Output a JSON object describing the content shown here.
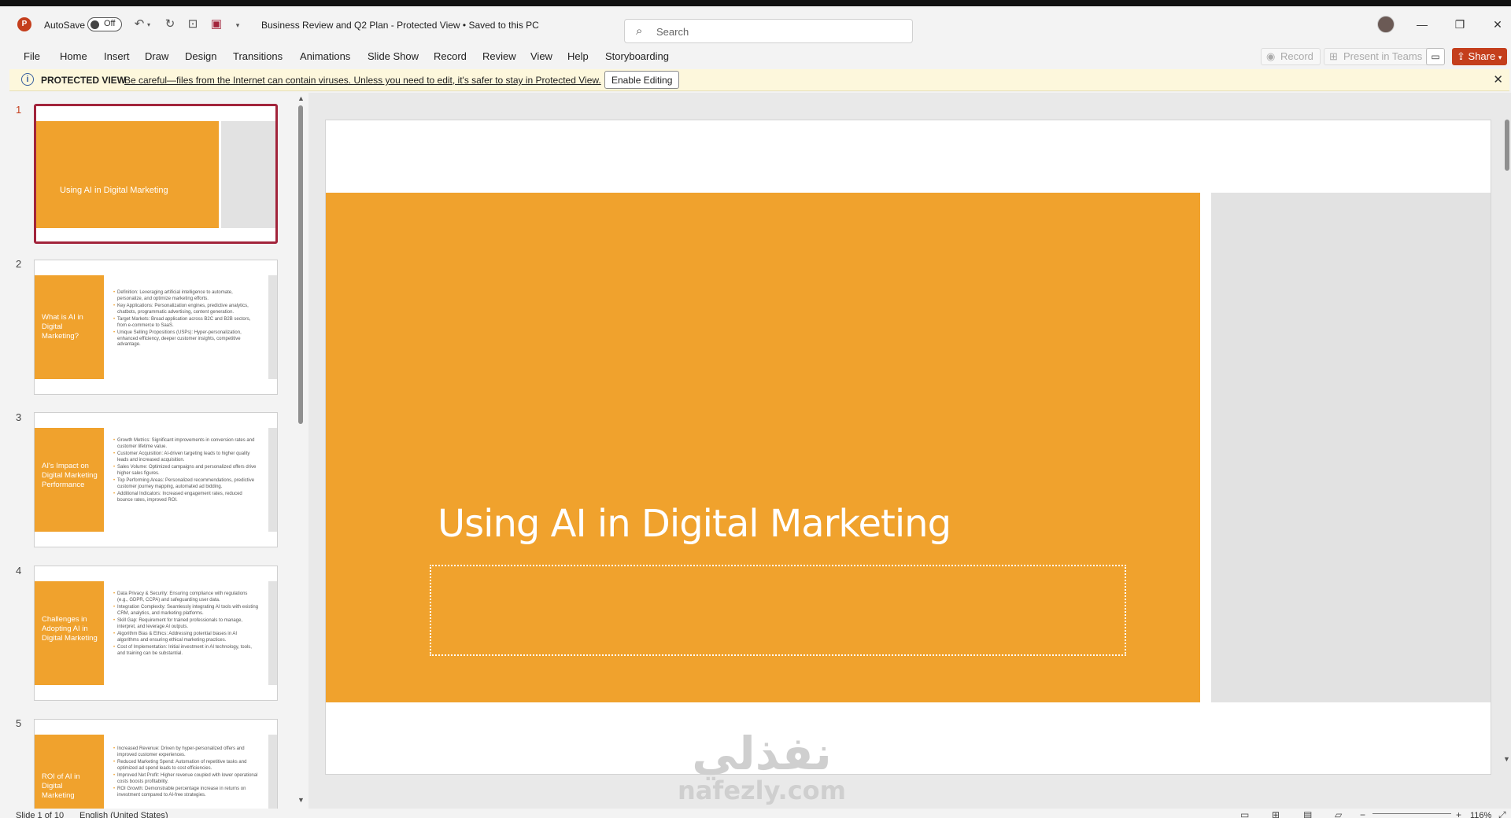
{
  "app": {
    "autosave_label": "AutoSave",
    "autosave_state": "Off",
    "doc_title": "Business Review and Q2 Plan  -  Protected View  •  Saved to this PC",
    "search_placeholder": "Search",
    "brand_color": "#c43e1c",
    "icons": [
      "powerpoint-logo-icon",
      "undo-icon",
      "redo-icon",
      "present-icon",
      "save-icon",
      "customize-icon",
      "search-icon",
      "avatar",
      "minimize-icon",
      "restore-icon",
      "close-icon"
    ]
  },
  "menu": {
    "items": [
      "File",
      "Home",
      "Insert",
      "Draw",
      "Design",
      "Transitions",
      "Animations",
      "Slide Show",
      "Record",
      "Review",
      "View",
      "Help",
      "Storyboarding"
    ],
    "record_label": "Record",
    "present_teams_label": "Present in Teams",
    "share_label": "Share"
  },
  "protected_view": {
    "title": "PROTECTED VIEW",
    "message": "Be careful—files from the Internet can contain viruses. Unless you need to edit, it's safer to stay in Protected View.",
    "button": "Enable Editing"
  },
  "slides": [
    {
      "num": "1",
      "title": "Using AI in Digital Marketing",
      "bullets": []
    },
    {
      "num": "2",
      "title": "What is AI in Digital Marketing?",
      "bullets": [
        "Definition: Leveraging artificial intelligence to automate, personalize, and optimize marketing efforts.",
        "Key Applications: Personalization engines, predictive analytics, chatbots, programmatic advertising, content generation.",
        "Target Markets: Broad application across B2C and B2B sectors, from e-commerce to SaaS.",
        "Unique Selling Propositions (USPs): Hyper-personalization, enhanced efficiency, deeper customer insights, competitive advantage."
      ]
    },
    {
      "num": "3",
      "title": "AI's Impact on Digital Marketing Performance",
      "bullets": [
        "Growth Metrics: Significant improvements in conversion rates and customer lifetime value.",
        "Customer Acquisition: AI-driven targeting leads to higher quality leads and increased acquisition.",
        "Sales Volume: Optimized campaigns and personalized offers drive higher sales figures.",
        "Top Performing Areas: Personalized recommendations, predictive customer journey mapping, automated ad bidding.",
        "Additional Indicators: Increased engagement rates, reduced bounce rates, improved ROI."
      ]
    },
    {
      "num": "4",
      "title": "Challenges in Adopting AI in Digital Marketing",
      "bullets": [
        "Data Privacy & Security: Ensuring compliance with regulations (e.g., GDPR, CCPA) and safeguarding user data.",
        "Integration Complexity: Seamlessly integrating AI tools with existing CRM, analytics, and marketing platforms.",
        "Skill Gap: Requirement for trained professionals to manage, interpret, and leverage AI outputs.",
        "Algorithm Bias & Ethics: Addressing potential biases in AI algorithms and ensuring ethical marketing practices.",
        "Cost of Implementation: Initial investment in AI technology, tools, and training can be substantial."
      ]
    },
    {
      "num": "5",
      "title": "ROI of AI in Digital Marketing",
      "bullets": [
        "Increased Revenue: Driven by hyper-personalized offers and improved customer experiences.",
        "Reduced Marketing Spend: Automation of repetitive tasks and optimized ad spend leads to cost efficiencies.",
        "Improved Net Profit: Higher revenue coupled with lower operational costs boosts profitability.",
        "ROI Growth: Demonstrable percentage increase in returns on investment compared to AI-free strategies."
      ]
    }
  ],
  "main_slide": {
    "title": "Using AI in Digital Marketing",
    "accent_color": "#f0a22d"
  },
  "watermark": {
    "arabic": "نفذلي",
    "latin": "nafezly.com"
  },
  "status": {
    "slide_indicator": "Slide 1 of 10",
    "language": "English (United States)",
    "zoom": "116%"
  }
}
